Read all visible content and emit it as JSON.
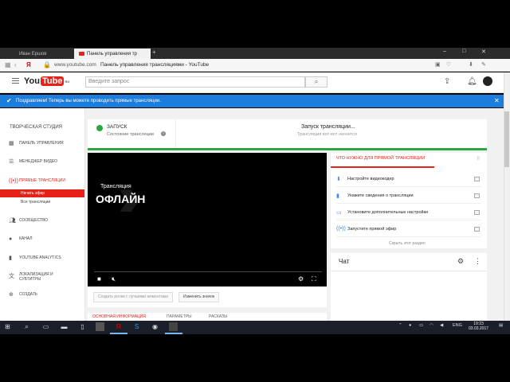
{
  "browser": {
    "tabs": [
      {
        "label": "Иван Ершов"
      },
      {
        "label": "Панель управления тр"
      }
    ],
    "new_tab": "+",
    "window_controls": [
      "–",
      "□",
      "✕"
    ],
    "ya_logo": "Я",
    "url": "www.youtube.com",
    "page_title": "Панель управления трансляциями - YouTube"
  },
  "header": {
    "logo_you": "You",
    "logo_tube": "Tube",
    "logo_region": "RU",
    "search_placeholder": "Введите запрос"
  },
  "banner": {
    "text": "Поздравляем! Теперь вы можете проводить прямые трансляции."
  },
  "sidebar": {
    "heading": "ТВОРЧЕСКАЯ СТУДИЯ",
    "items": [
      {
        "label": "ПАНЕЛЬ УПРАВЛЕНИЯ",
        "icon": "dashboard-icon"
      },
      {
        "label": "МЕНЕДЖЕР ВИДЕО",
        "icon": "video-manager-icon"
      },
      {
        "label": "ПРЯМЫЕ ТРАНСЛЯЦИИ",
        "icon": "live-icon"
      },
      {
        "label": "СООБЩЕСТВО",
        "icon": "community-icon"
      },
      {
        "label": "КАНАЛ",
        "icon": "channel-icon"
      },
      {
        "label": "YOUTUBE ANALYTICS",
        "icon": "analytics-icon"
      },
      {
        "label": "ЛОКАЛИЗАЦИЯ И СУБТИТРЫ",
        "icon": "translate-icon"
      },
      {
        "label": "СОЗДАТЬ",
        "icon": "create-icon"
      }
    ],
    "subitems": [
      {
        "label": "Начать эфир"
      },
      {
        "label": "Все трансляции"
      }
    ]
  },
  "status": {
    "start_label": "ЗАПУСК",
    "start_sub": "Состояние трансляции",
    "help": "?",
    "launch_title": "Запуск трансляции...",
    "launch_sub": "Трансляция вот-вот начнется"
  },
  "player": {
    "subtitle": "Трансляция",
    "state": "ОФЛАЙН"
  },
  "under_player": {
    "create_clip": "Создать ролик с лучшими моментами",
    "change_thumb": "Изменить значок"
  },
  "bottom_tabs": [
    {
      "label": "ОСНОВНАЯ ИНФОРМАЦИЯ"
    },
    {
      "label": "ПАРАМЕТРЫ"
    },
    {
      "label": "РАСКАЗЫ"
    }
  ],
  "checklist": {
    "title": "ЧТО НУЖНО ДЛЯ ПРЯМОЙ ТРАНСЛЯЦИИ",
    "items": [
      {
        "label": "Настройте видеокодер",
        "icon": "download-icon"
      },
      {
        "label": "Укажите сведения о трансляции",
        "icon": "chart-icon"
      },
      {
        "label": "Установите дополнительные настройки",
        "icon": "card-icon"
      },
      {
        "label": "Запустите прямой эфир",
        "icon": "broadcast-icon"
      }
    ],
    "hide": "Скрыть этот раздел"
  },
  "chat": {
    "title": "Чат"
  },
  "taskbar": {
    "lang": "ENG",
    "time": "19:23",
    "date": "03.03.2017"
  },
  "colors": {
    "brand_red": "#e62117",
    "banner_blue": "#1c7ddd",
    "status_green": "#2ba640"
  }
}
